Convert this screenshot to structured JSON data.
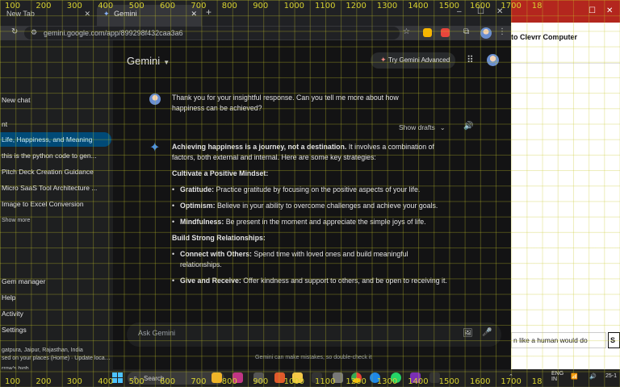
{
  "tabs": [
    {
      "label": "New Tab",
      "active": false
    },
    {
      "label": "Gemini",
      "active": true
    }
  ],
  "toolbar": {
    "url": "gemini.google.com/app/899298f432caa3a6"
  },
  "sidebar": {
    "new_chat": "New chat",
    "recent_label": "nt",
    "items": [
      {
        "label": "Life, Happiness, and Meaning",
        "active": true
      },
      {
        "label": "this is the python code to gen...",
        "active": false
      },
      {
        "label": "Pitch Deck Creation Guidance",
        "active": false
      },
      {
        "label": "Micro SaaS Tool Architecture ...",
        "active": false
      },
      {
        "label": "Image to Excel Conversion",
        "active": false
      }
    ],
    "show_more": "Show more",
    "gem_manager": "Gem manager",
    "help": "Help",
    "activity": "Activity",
    "settings": "Settings",
    "location": "gatpura, Jaipur, Rajasthan, India",
    "location_sub": "sed on your places (Home) · Update location",
    "weather1": "rrow's high",
    "weather2": "recast"
  },
  "header": {
    "brand": "Gemini",
    "advanced_btn": "Try Gemini Advanced"
  },
  "conversation": {
    "user_prompt": "Thank you for your insightful response. Can you tell me more about how happiness can be achieved?",
    "show_drafts": "Show drafts",
    "response": {
      "intro_bold": "Achieving happiness is a journey, not a destination.",
      "intro_rest": " It involves a combination of factors, both external and internal. Here are some key strategies:",
      "heading1": "Cultivate a Positive Mindset:",
      "list1": [
        {
          "term": "Gratitude:",
          "text": " Practice gratitude by focusing on the positive aspects of your life."
        },
        {
          "term": "Optimism:",
          "text": " Believe in your ability to overcome challenges and achieve your goals."
        },
        {
          "term": "Mindfulness:",
          "text": " Be present in the moment and appreciate the simple joys of life."
        }
      ],
      "heading2": "Build Strong Relationships:",
      "list2": [
        {
          "term": "Connect with Others:",
          "text": " Spend time with loved ones and build meaningful relationships."
        },
        {
          "term": "Give and Receive:",
          "text": " Offer kindness and support to others, and be open to receiving it."
        }
      ]
    }
  },
  "input": {
    "placeholder": "Ask Gemini"
  },
  "disclaimer": "Gemini can make mistakes, so double-check it",
  "right_window": {
    "title": "to Clevrr Computer",
    "box_text": "n like a human would do",
    "box_btn": "S"
  },
  "taskbar": {
    "search": "Search",
    "lang1": "ENG",
    "lang2": "IN",
    "time": "25-1"
  },
  "grid_labels": [
    "100",
    "200",
    "300",
    "400",
    "500",
    "600",
    "700",
    "800",
    "900",
    "1000",
    "1100",
    "1200",
    "1300",
    "1400",
    "1500",
    "1600",
    "1700",
    "18"
  ],
  "colors": {
    "accent": "#004a77",
    "bg": "#131314",
    "sidebar": "#1e1f20",
    "gem_blue": "#4a90e2"
  }
}
